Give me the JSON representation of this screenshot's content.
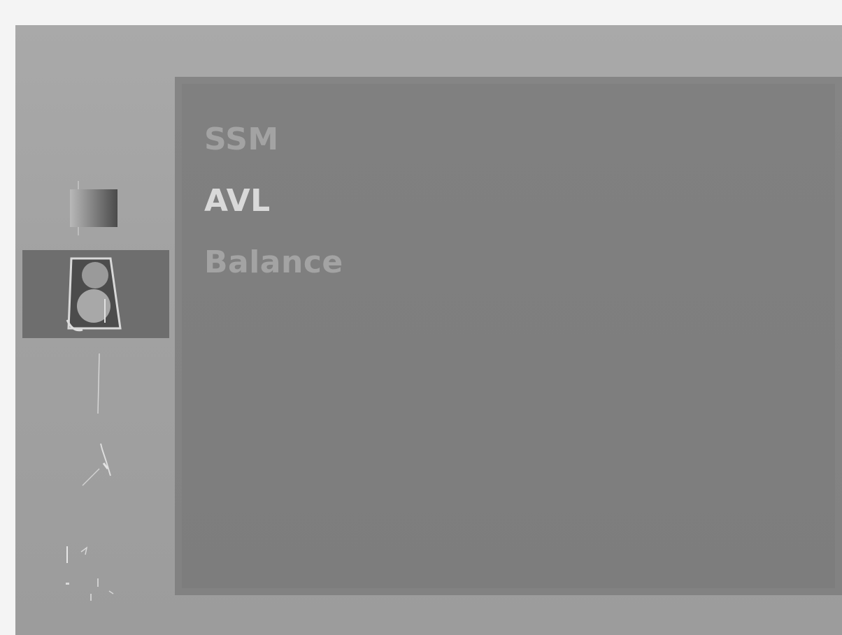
{
  "side_menu": [
    {
      "id": "picture",
      "icon": "picture-icon",
      "selected": false
    },
    {
      "id": "sound",
      "icon": "speaker-icon",
      "selected": true
    },
    {
      "id": "time",
      "icon": "clock-icon",
      "selected": false
    },
    {
      "id": "special",
      "icon": "special-icon",
      "selected": false
    },
    {
      "id": "screen",
      "icon": "screen-icon",
      "selected": false
    }
  ],
  "sound_menu": {
    "items": [
      {
        "label": "SSM",
        "active": false
      },
      {
        "label": "AVL",
        "active": true
      },
      {
        "label": "Balance",
        "active": false
      }
    ]
  },
  "colors": {
    "frame": "#a5a5a5",
    "panel": "#7f7f7f",
    "selected_tab": "#6e6e6e",
    "active_text": "#d9d9d9",
    "inactive_text": "#a3a3a3"
  }
}
